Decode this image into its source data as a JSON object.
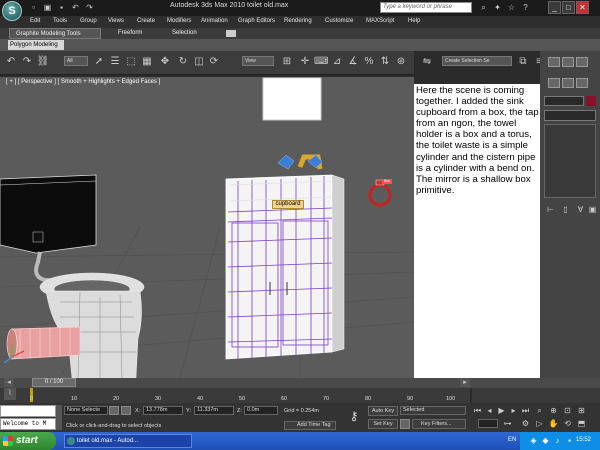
{
  "window": {
    "title": "Autodesk 3ds Max  2010       toilet old.max",
    "search_placeholder": "Type a keyword or phrase"
  },
  "menu": [
    "Edit",
    "Tools",
    "Group",
    "Views",
    "Create",
    "Modifiers",
    "Animation",
    "Graph Editors",
    "Rendering",
    "Customize",
    "MAXScript",
    "Help"
  ],
  "ribbon": {
    "tabs": [
      "Graphite Modeling Tools",
      "Freeform",
      "Selection"
    ],
    "sub_tab": "Polygon Modeling"
  },
  "toolbar": {
    "filter_value": "All",
    "refcoord_value": "View",
    "named_selection": "Create Selection Se"
  },
  "viewport": {
    "label": "[ + ] [ Perspective ] [ Smooth + Highlights + Edged Faces ]",
    "cupboard_label": "cupboard",
    "towel_label": "Box"
  },
  "note": "Here the scene is coming together. I added the sink cupboard from a box, the tap from an ngon, the towel holder is a box and a torus, the toilet waste is a simple cylinder and the cistern pipe is a cylinder with a bend on. The mirror is a shallow box primitive.",
  "timeline": {
    "frame_display": "0 / 100",
    "ticks": [
      "0",
      "10",
      "20",
      "30",
      "40",
      "50",
      "60",
      "70",
      "80",
      "90",
      "100"
    ]
  },
  "status": {
    "maxscript_listener": "Welcome to M",
    "selection_info": "None Selecte",
    "prompt": "Click or click-and-drag to select objects",
    "x_label": "X:",
    "x_value": "13.778m",
    "y_label": "Y:",
    "y_value": "11.337m",
    "z_label": "Z:",
    "z_value": "0.0m",
    "grid": "Grid = 0.254m",
    "add_time_tag": "Add Time Tag",
    "auto_key": "Auto Key",
    "auto_key_mode": "Selected",
    "set_key": "Set Key",
    "key_filters": "Key Filters..."
  },
  "taskbar": {
    "start": "start",
    "task": "toilet old.max - Autod...",
    "lang": "EN",
    "clock": "15:52"
  },
  "colors": {
    "viewport_bg": "#5b5b5b",
    "wire_white": "#ffffff",
    "wire_purple": "#7a3cc8",
    "taskbar_blue": "#2a5fcd",
    "start_green": "#3a9a3a"
  }
}
